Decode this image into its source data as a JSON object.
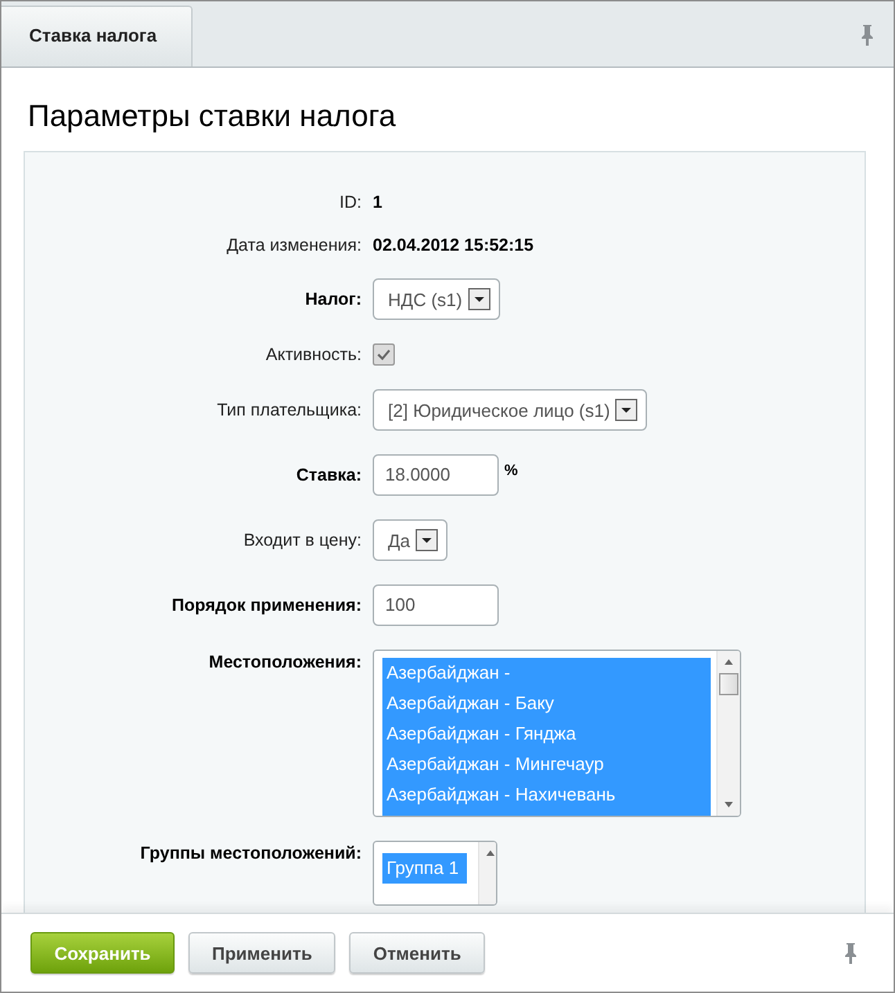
{
  "tabs": [
    {
      "label": "Ставка налога",
      "selected": true
    }
  ],
  "title": "Параметры ставки налога",
  "fields": [
    {
      "kind": "text",
      "label": "ID:",
      "required": false,
      "value": "1"
    },
    {
      "kind": "text",
      "label": "Дата изменения:",
      "required": false,
      "value": "02.04.2012 15:52:15"
    },
    {
      "kind": "select",
      "label": "Налог:",
      "required": true,
      "value": "НДС (s1)"
    },
    {
      "kind": "checkbox",
      "label": "Активность:",
      "required": false,
      "checked": true
    },
    {
      "kind": "select",
      "label": "Тип плательщика:",
      "required": false,
      "value": "[2] Юридическое лицо (s1)"
    },
    {
      "kind": "input",
      "label": "Ставка:",
      "required": true,
      "value": "18.0000",
      "suffix": "%"
    },
    {
      "kind": "select",
      "label": "Входит в цену:",
      "required": false,
      "value": "Да"
    },
    {
      "kind": "input",
      "label": "Порядок применения:",
      "required": true,
      "value": "100"
    },
    {
      "kind": "list",
      "label": "Местоположения:",
      "required": true,
      "items": [
        {
          "label": "Азербайджан -",
          "selected": true
        },
        {
          "label": "Азербайджан - Баку",
          "selected": true
        },
        {
          "label": "Азербайджан - Гянджа",
          "selected": true
        },
        {
          "label": "Азербайджан - Мингечаур",
          "selected": true
        },
        {
          "label": "Азербайджан - Нахичевань",
          "selected": true
        }
      ]
    },
    {
      "kind": "list",
      "label": "Группы местоположений:",
      "required": true,
      "items": [
        {
          "label": "Группа 1",
          "selected": true
        }
      ]
    }
  ],
  "buttons": [
    {
      "label": "Сохранить",
      "kind": "primary"
    },
    {
      "label": "Применить",
      "kind": "default"
    },
    {
      "label": "Отменить",
      "kind": "default"
    }
  ]
}
